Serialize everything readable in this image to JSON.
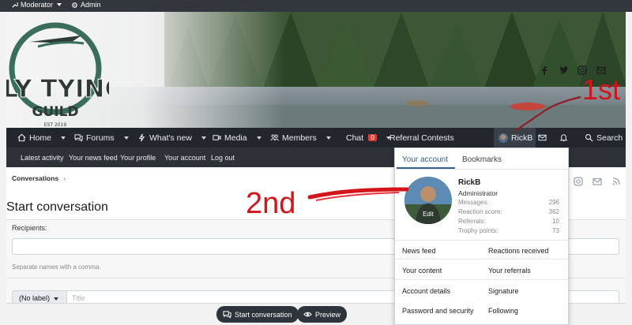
{
  "staff_bar": {
    "moderator": "Moderator",
    "admin": "Admin"
  },
  "brand": {
    "logo_line1": "FLY TYING",
    "logo_line2": "GUILD",
    "logo_est": "EST 2019"
  },
  "nav": {
    "home": "Home",
    "forums": "Forums",
    "whats_new": "What's new",
    "media": "Media",
    "members": "Members",
    "chat": "Chat",
    "chat_badge": "0",
    "referral": "Referral Contests",
    "user": "RickB",
    "search": "Search"
  },
  "subnav": {
    "items": [
      "Latest activity",
      "Your news feed",
      "Your profile",
      "Your account",
      "Log out"
    ]
  },
  "breadcrumb": "Conversations",
  "page": {
    "title": "Start conversation",
    "recipients_label": "Recipients:",
    "recipients_hint": "Separate names with a comma.",
    "prefix": "(No label)",
    "title_placeholder": "Title",
    "start_button": "Start conversation",
    "preview_button": "Preview"
  },
  "account_menu": {
    "tabs": [
      "Your account",
      "Bookmarks"
    ],
    "username": "RickB",
    "role": "Administrator",
    "avatar_edit": "Edit",
    "stats": [
      {
        "label": "Messages:",
        "value": "296"
      },
      {
        "label": "Reaction score:",
        "value": "362"
      },
      {
        "label": "Referrals:",
        "value": "10"
      },
      {
        "label": "Trophy points:",
        "value": "73"
      }
    ],
    "links_left": [
      "News feed",
      "Your content",
      "Account details",
      "Password and security"
    ],
    "links_right": [
      "Reactions received",
      "Your referrals",
      "Signature",
      "Following"
    ]
  },
  "annotations": {
    "first": "1st",
    "second": "2nd"
  },
  "colors": {
    "nav_bg": "#22272d",
    "accent": "#355f85",
    "annotation": "#d4141b",
    "badge": "#e03c31"
  }
}
